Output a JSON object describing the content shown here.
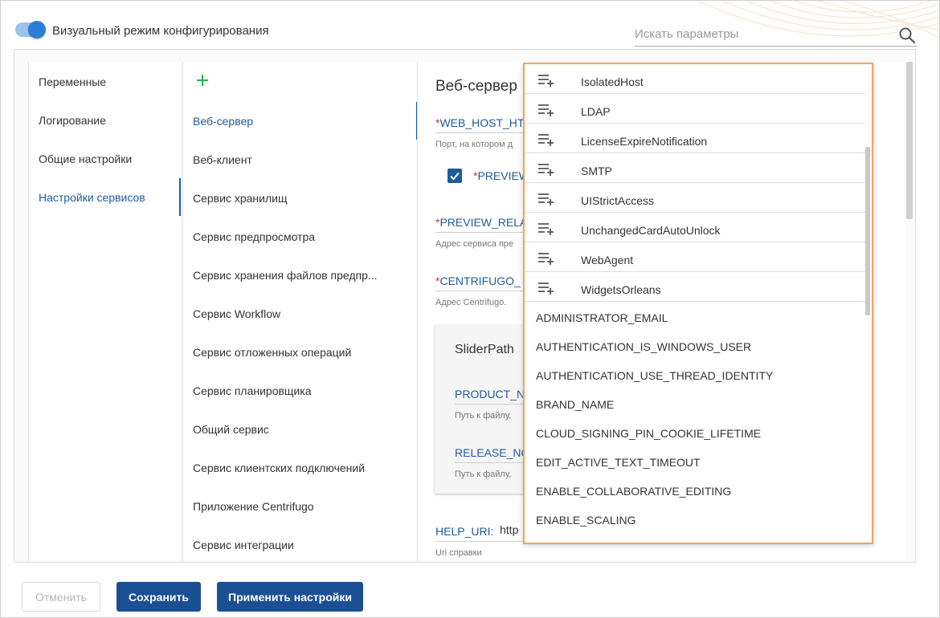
{
  "header": {
    "toggle_label": "Визуальный режим конфигурирования",
    "search_placeholder": "Искать параметры"
  },
  "categories": [
    {
      "label": "Переменные"
    },
    {
      "label": "Логирование"
    },
    {
      "label": "Общие настройки"
    },
    {
      "label": "Настройки сервисов",
      "active": true
    }
  ],
  "services": [
    {
      "label": "Веб-сервер",
      "active": true
    },
    {
      "label": "Веб-клиент"
    },
    {
      "label": "Сервис хранилищ"
    },
    {
      "label": "Сервис предпросмотра"
    },
    {
      "label": "Сервис хранения файлов предпр..."
    },
    {
      "label": "Сервис Workflow"
    },
    {
      "label": "Сервис отложенных операций"
    },
    {
      "label": "Сервис планировщика"
    },
    {
      "label": "Общий сервис"
    },
    {
      "label": "Сервис клиентских подключений"
    },
    {
      "label": "Приложение Centrifugo"
    },
    {
      "label": "Сервис интеграции"
    }
  ],
  "editor": {
    "section_title": "Веб-сервер",
    "params": {
      "web_host": {
        "req": "*",
        "name": "WEB_HOST_HT",
        "desc": "Порт, на котором д"
      },
      "preview": {
        "req": "*",
        "name": "PREVIEW"
      },
      "preview_rel": {
        "req": "*",
        "name": "PREVIEW_RELA",
        "desc": "Адрес сервиса пре"
      },
      "centrifugo": {
        "req": "*",
        "name": "CENTRIFUGO_",
        "desc": "Адрес Centrifugo."
      },
      "help_uri": {
        "name": "HELP_URI:",
        "value": "http",
        "desc": "Uri справки"
      }
    },
    "card": {
      "title": "SliderPath",
      "product": {
        "name": "PRODUCT_N",
        "desc": "Путь к файлу,"
      },
      "release": {
        "name": "RELEASE_NO",
        "desc": "Путь к файлу,"
      }
    }
  },
  "dropdown": {
    "groups": [
      "IsolatedHost",
      "LDAP",
      "LicenseExpireNotification",
      "SMTP",
      "UIStrictAccess",
      "UnchangedCardAutoUnlock",
      "WebAgent",
      "WidgetsOrleans"
    ],
    "params": [
      "ADMINISTRATOR_EMAIL",
      "AUTHENTICATION_IS_WINDOWS_USER",
      "AUTHENTICATION_USE_THREAD_IDENTITY",
      "BRAND_NAME",
      "CLOUD_SIGNING_PIN_COOKIE_LIFETIME",
      "EDIT_ACTIVE_TEXT_TIMEOUT",
      "ENABLE_COLLABORATIVE_EDITING",
      "ENABLE_SCALING"
    ]
  },
  "footer": {
    "cancel": "Отменить",
    "save": "Сохранить",
    "apply": "Применить настройки"
  },
  "colors": {
    "accent": "#1f5a9a",
    "button": "#1a4f93",
    "highlight_border": "#f0a55a",
    "required": "#d0312d",
    "add_icon": "#2ab24a"
  }
}
